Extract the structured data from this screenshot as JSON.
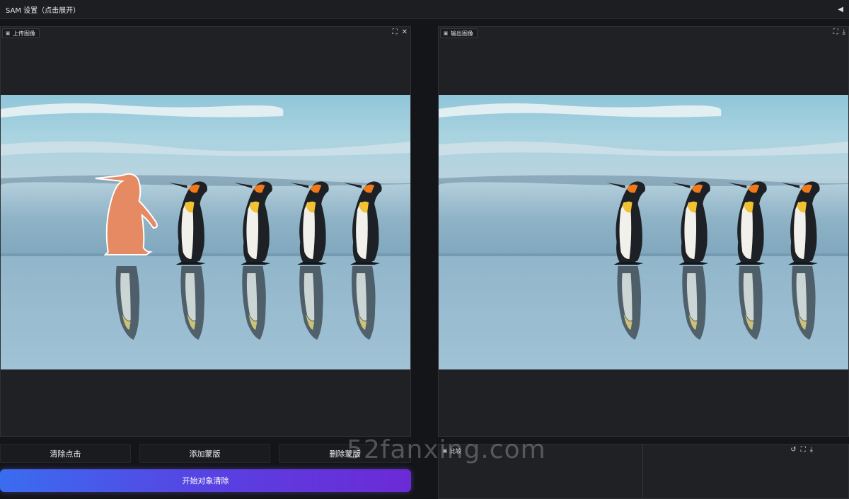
{
  "topbar": {
    "title": "SAM 设置（点击展开）",
    "collapse_icon": "◀"
  },
  "input_panel": {
    "label": "上传图像",
    "icon": "image-icon",
    "tools": [
      "fullscreen-icon",
      "close-icon"
    ]
  },
  "output_panel": {
    "label": "输出图像",
    "icon": "image-icon",
    "tools": [
      "fullscreen-icon",
      "download-icon"
    ]
  },
  "compare_panel": {
    "label": "比较",
    "icon": "image-icon",
    "tools": [
      "undo-icon",
      "fullscreen-icon",
      "download-icon"
    ]
  },
  "buttons": {
    "clear_points": "清除点击",
    "add_mask": "添加蒙版",
    "delete_mask": "删除蒙版",
    "start_removal": "开始对象清除"
  },
  "watermark": "52fanxing.com",
  "colors": {
    "accent_start": "#3a6df0",
    "accent_end": "#6c2ad6",
    "mask_highlight": "#e58a63"
  }
}
